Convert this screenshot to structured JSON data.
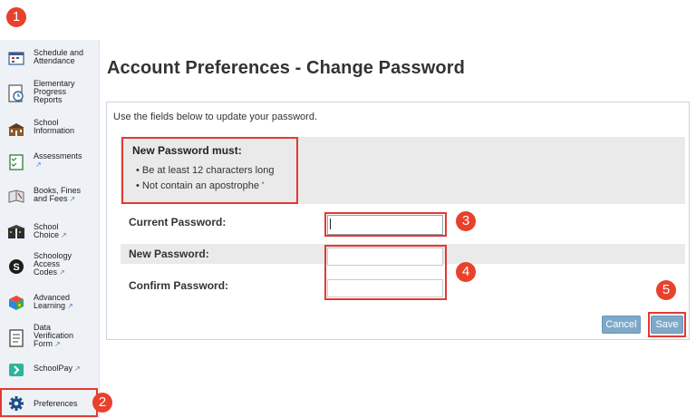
{
  "callouts": [
    "1",
    "2",
    "3",
    "4",
    "5"
  ],
  "sidebar": {
    "items": [
      {
        "label": "Schedule and\nAttendance",
        "icon": "calendar-icon",
        "external": false
      },
      {
        "label": "Elementary\nProgress\nReports",
        "icon": "clock-report-icon",
        "external": false
      },
      {
        "label": "School\nInformation",
        "icon": "school-building-icon",
        "external": false
      },
      {
        "label": "Assessments",
        "icon": "checklist-icon",
        "external": true
      },
      {
        "label": "Books, Fines\nand Fees",
        "icon": "book-icon",
        "external": true
      },
      {
        "label": "School\nChoice",
        "icon": "schools-icon",
        "external": true
      },
      {
        "label": "Schoology\nAccess\nCodes",
        "icon": "schoology-icon",
        "external": true
      },
      {
        "label": "Advanced\nLearning",
        "icon": "cube-icon",
        "external": true
      },
      {
        "label": "Data\nVerification\nForm",
        "icon": "form-icon",
        "external": true
      },
      {
        "label": "SchoolPay",
        "icon": "chevron-right-icon",
        "external": true
      },
      {
        "label": "Preferences",
        "icon": "gear-icon",
        "external": false
      }
    ],
    "external_mark": "↗"
  },
  "main": {
    "title": "Account Preferences - Change Password",
    "intro": "Use the fields below to update your password.",
    "rules_title": "New Password must:",
    "rules": [
      "Be at least 12 characters long",
      "Not contain an apostrophe '"
    ],
    "current_label": "Current Password:",
    "new_label": "New Password:",
    "confirm_label": "Confirm Password:",
    "cancel_label": "Cancel",
    "save_label": "Save"
  },
  "colors": {
    "accent_red": "#e23a31",
    "callout_red": "#e8412c",
    "button_blue": "#7fa9c8"
  }
}
